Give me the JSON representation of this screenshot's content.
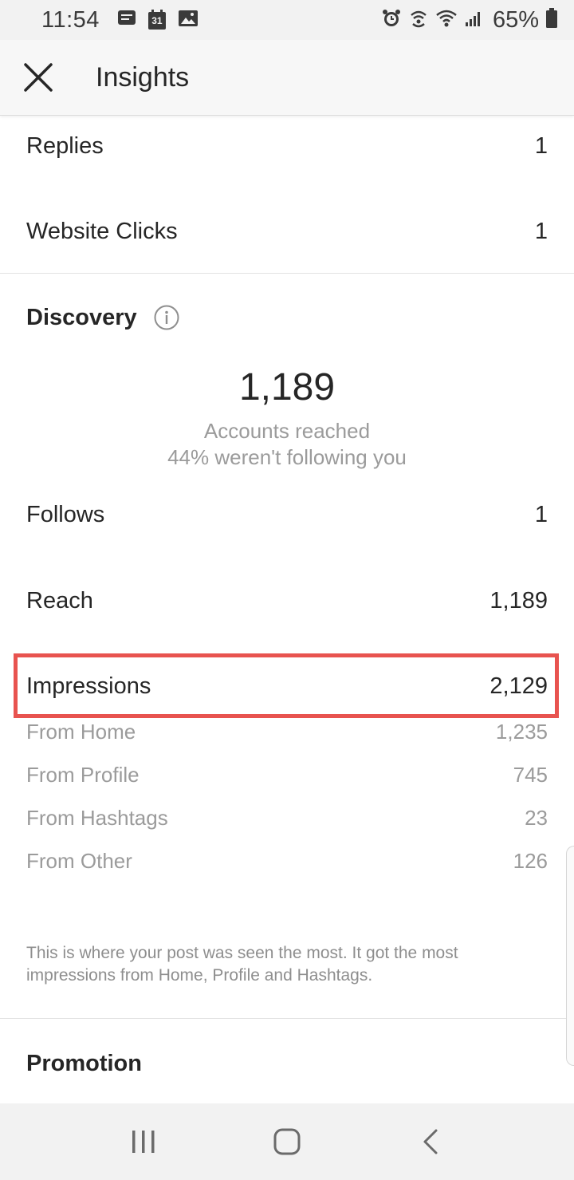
{
  "status_bar": {
    "time": "11:54",
    "battery": "65%",
    "left_icons": [
      "message-icon",
      "calendar-icon",
      "image-icon"
    ],
    "calendar_day": "31",
    "right_icons": [
      "alarm-icon",
      "hotspot-icon",
      "wifi-icon",
      "signal-icon",
      "battery-icon"
    ]
  },
  "header": {
    "title": "Insights"
  },
  "interactions": [
    {
      "label": "Replies",
      "value": "1"
    },
    {
      "label": "Website Clicks",
      "value": "1"
    }
  ],
  "discovery": {
    "title": "Discovery",
    "accounts_reached": "1,189",
    "accounts_reached_label": "Accounts reached",
    "not_following_label": "44% weren't following you",
    "rows": [
      {
        "label": "Follows",
        "value": "1"
      },
      {
        "label": "Reach",
        "value": "1,189"
      },
      {
        "label": "Impressions",
        "value": "2,129"
      }
    ],
    "impression_sources": [
      {
        "label": "From Home",
        "value": "1,235"
      },
      {
        "label": "From Profile",
        "value": "745"
      },
      {
        "label": "From Hashtags",
        "value": "23"
      },
      {
        "label": "From Other",
        "value": "126"
      }
    ],
    "note": "This is where your post was seen the most. It got the most impressions from Home, Profile and Hashtags."
  },
  "promotion": {
    "title": "Promotion"
  },
  "colors": {
    "highlight_border": "#e8534f",
    "muted_text": "#9b9b9b",
    "primary_text": "#262626"
  }
}
